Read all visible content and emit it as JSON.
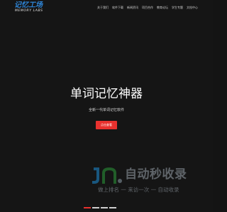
{
  "logo": {
    "main": "记忆工场",
    "sub": "MEMORY LABS"
  },
  "nav": {
    "items": [
      {
        "label": "关于我们"
      },
      {
        "label": "软件下载"
      },
      {
        "label": "新闻资讯"
      },
      {
        "label": "项目合作"
      },
      {
        "label": "教育论坛"
      },
      {
        "label": "学生专题"
      },
      {
        "label": "文档中心"
      }
    ]
  },
  "hero": {
    "title": "单词记忆神器",
    "subtitle": "全新一代单词记忆软件",
    "cta_label": "点击查看"
  },
  "watermark": {
    "main": "自动秒收录",
    "sub": "做上排名 一 来访一次 一 自动收录"
  },
  "slider": {
    "count": 4,
    "active_index": 0
  },
  "colors": {
    "background": "#151515",
    "accent": "#e8312e",
    "logo_blue": "#2e86d8"
  }
}
